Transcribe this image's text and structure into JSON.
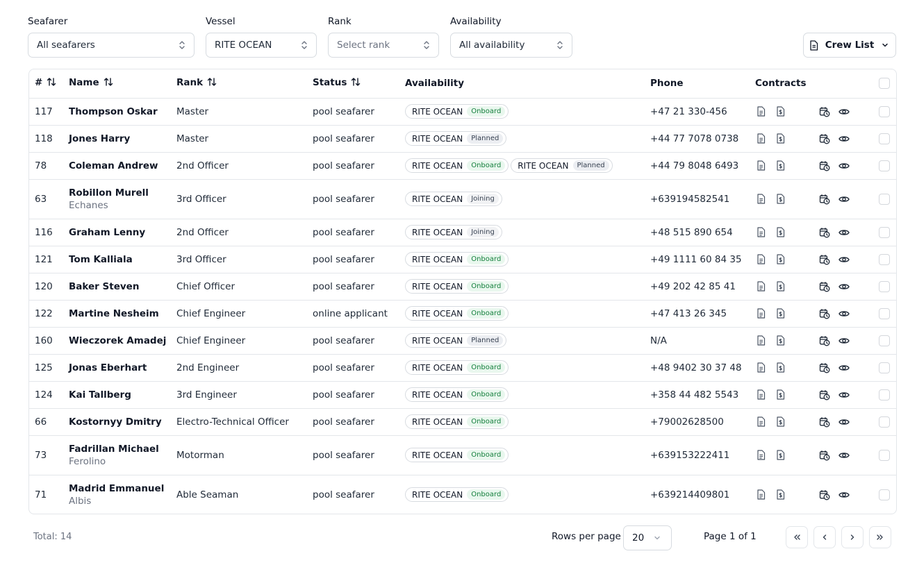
{
  "filters": {
    "seafarer": {
      "label": "Seafarer",
      "value": "All seafarers"
    },
    "vessel": {
      "label": "Vessel",
      "value": "RITE OCEAN"
    },
    "rank": {
      "label": "Rank",
      "placeholder": "Select rank"
    },
    "availability": {
      "label": "Availability",
      "value": "All availability"
    }
  },
  "crew_list_button": "Crew List",
  "table": {
    "headers": {
      "num": "#",
      "name": "Name",
      "rank": "Rank",
      "status": "Status",
      "availability": "Availability",
      "phone": "Phone",
      "contracts": "Contracts"
    },
    "rows": [
      {
        "num": "117",
        "name": "Thompson Oskar",
        "sub": "",
        "rank": "Master",
        "status": "pool seafarer",
        "avail": [
          {
            "vessel": "RITE OCEAN",
            "state": "Onboard"
          }
        ],
        "phone": "+47 21 330-456"
      },
      {
        "num": "118",
        "name": "Jones Harry",
        "sub": "",
        "rank": "Master",
        "status": "pool seafarer",
        "avail": [
          {
            "vessel": "RITE OCEAN",
            "state": "Planned"
          }
        ],
        "phone": "+44 77 7078 0738"
      },
      {
        "num": "78",
        "name": "Coleman Andrew",
        "sub": "",
        "rank": "2nd Officer",
        "status": "pool seafarer",
        "avail": [
          {
            "vessel": "RITE OCEAN",
            "state": "Onboard"
          },
          {
            "vessel": "RITE OCEAN",
            "state": "Planned"
          }
        ],
        "phone": "+44 79 8048 6493"
      },
      {
        "num": "63",
        "name": "Robillon Murell",
        "sub": "Echanes",
        "rank": "3rd Officer",
        "status": "pool seafarer",
        "avail": [
          {
            "vessel": "RITE OCEAN",
            "state": "Joining"
          }
        ],
        "phone": "+639194582541"
      },
      {
        "num": "116",
        "name": "Graham Lenny",
        "sub": "",
        "rank": "2nd Officer",
        "status": "pool seafarer",
        "avail": [
          {
            "vessel": "RITE OCEAN",
            "state": "Joining"
          }
        ],
        "phone": "+48 515 890 654"
      },
      {
        "num": "121",
        "name": "Tom Kalliala",
        "sub": "",
        "rank": "3rd Officer",
        "status": "pool seafarer",
        "avail": [
          {
            "vessel": "RITE OCEAN",
            "state": "Onboard"
          }
        ],
        "phone": "+49 1111 60 84 35"
      },
      {
        "num": "120",
        "name": "Baker Steven",
        "sub": "",
        "rank": "Chief Officer",
        "status": "pool seafarer",
        "avail": [
          {
            "vessel": "RITE OCEAN",
            "state": "Onboard"
          }
        ],
        "phone": "+49 202 42 85 41"
      },
      {
        "num": "122",
        "name": "Martine Nesheim",
        "sub": "",
        "rank": "Chief Engineer",
        "status": "online applicant",
        "avail": [
          {
            "vessel": "RITE OCEAN",
            "state": "Onboard"
          }
        ],
        "phone": "+47 413 26 345"
      },
      {
        "num": "160",
        "name": "Wieczorek Amadej",
        "sub": "",
        "rank": "Chief Engineer",
        "status": "pool seafarer",
        "avail": [
          {
            "vessel": "RITE OCEAN",
            "state": "Planned"
          }
        ],
        "phone": "N/A"
      },
      {
        "num": "125",
        "name": "Jonas Eberhart",
        "sub": "",
        "rank": "2nd Engineer",
        "status": "pool seafarer",
        "avail": [
          {
            "vessel": "RITE OCEAN",
            "state": "Onboard"
          }
        ],
        "phone": "+48 9402 30 37 48"
      },
      {
        "num": "124",
        "name": "Kai Tallberg",
        "sub": "",
        "rank": "3rd Engineer",
        "status": "pool seafarer",
        "avail": [
          {
            "vessel": "RITE OCEAN",
            "state": "Onboard"
          }
        ],
        "phone": "+358 44 482 5543"
      },
      {
        "num": "66",
        "name": "Kostornyy Dmitry",
        "sub": "",
        "rank": "Electro-Technical Officer",
        "status": "pool seafarer",
        "avail": [
          {
            "vessel": "RITE OCEAN",
            "state": "Onboard"
          }
        ],
        "phone": "+79002628500"
      },
      {
        "num": "73",
        "name": "Fadrillan Michael",
        "sub": "Ferolino",
        "rank": "Motorman",
        "status": "pool seafarer",
        "avail": [
          {
            "vessel": "RITE OCEAN",
            "state": "Onboard"
          }
        ],
        "phone": "+639153222411"
      },
      {
        "num": "71",
        "name": "Madrid Emmanuel",
        "sub": "Albis",
        "rank": "Able Seaman",
        "status": "pool seafarer",
        "avail": [
          {
            "vessel": "RITE OCEAN",
            "state": "Onboard"
          }
        ],
        "phone": "+639214409801"
      }
    ]
  },
  "footer": {
    "total": "Total: 14",
    "rows_per_page_label": "Rows per page",
    "rows_per_page_value": "20",
    "page_info": "Page 1 of 1"
  },
  "icons": {
    "contract_doc": "file-text-icon",
    "contract_pay": "dollar-file-icon",
    "schedule": "calendar-clock-icon",
    "view": "eye-icon",
    "crew_list": "file-icon",
    "sort": "sort-arrows-icon",
    "select_chevron": "chevron-up-down-icon",
    "pagination": [
      "first-page-icon",
      "prev-page-icon",
      "next-page-icon",
      "last-page-icon"
    ]
  },
  "colors": {
    "onboard_bg": "#e9f7ee",
    "onboard_text": "#15803d",
    "planned_bg": "#eceef2",
    "border": "#e3e6ea"
  }
}
